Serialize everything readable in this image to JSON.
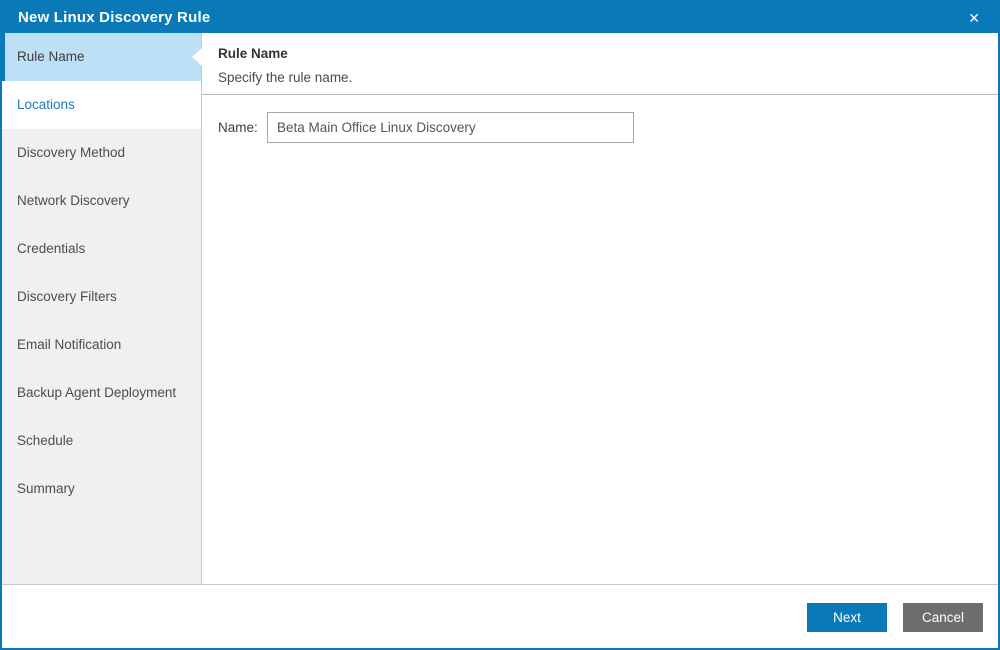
{
  "window": {
    "title": "New Linux Discovery Rule",
    "close_glyph": "✕"
  },
  "sidebar": {
    "items": [
      {
        "label": "Rule Name",
        "state": "selected"
      },
      {
        "label": "Locations",
        "state": "link"
      },
      {
        "label": "Discovery Method",
        "state": "normal"
      },
      {
        "label": "Network Discovery",
        "state": "normal"
      },
      {
        "label": "Credentials",
        "state": "normal"
      },
      {
        "label": "Discovery Filters",
        "state": "normal"
      },
      {
        "label": "Email Notification",
        "state": "normal"
      },
      {
        "label": "Backup Agent Deployment",
        "state": "normal"
      },
      {
        "label": "Schedule",
        "state": "normal"
      },
      {
        "label": "Summary",
        "state": "normal"
      }
    ]
  },
  "main": {
    "heading": "Rule Name",
    "description": "Specify the rule name.",
    "name_label": "Name:",
    "name_value": "Beta Main Office Linux Discovery"
  },
  "footer": {
    "next_label": "Next",
    "cancel_label": "Cancel"
  },
  "colors": {
    "accent_blue": "#0a79b8",
    "selected_step_bg": "#bee0f7",
    "step_link_text": "#1d7ab9",
    "sidebar_bg": "#f0f0f0",
    "cancel_gray": "#6d6d6d"
  }
}
